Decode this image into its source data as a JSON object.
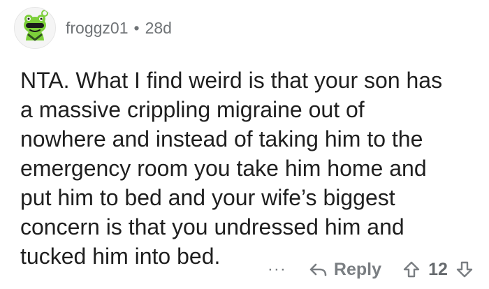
{
  "comment": {
    "author": "froggz01",
    "separator": "•",
    "age": "28d",
    "body": "NTA. What I find weird is that your son has\na massive crippling migraine out of\nnowhere and instead of taking him to the\nemergency room you take him home and\nput him to bed and your wife’s biggest\nconcern is that you undressed him and\ntucked him into bed."
  },
  "actions": {
    "more_label": "···",
    "reply_label": "Reply",
    "score": "12"
  },
  "icons": {
    "avatar": "frog-avatar-icon",
    "reply": "reply-arrow-icon",
    "upvote": "upvote-arrow-icon",
    "downvote": "downvote-arrow-icon"
  },
  "colors": {
    "meta_text": "#6f7376",
    "body_text": "#1f1f1f",
    "action_text": "#7a7e82",
    "avatar_green": "#7ccf3a"
  }
}
